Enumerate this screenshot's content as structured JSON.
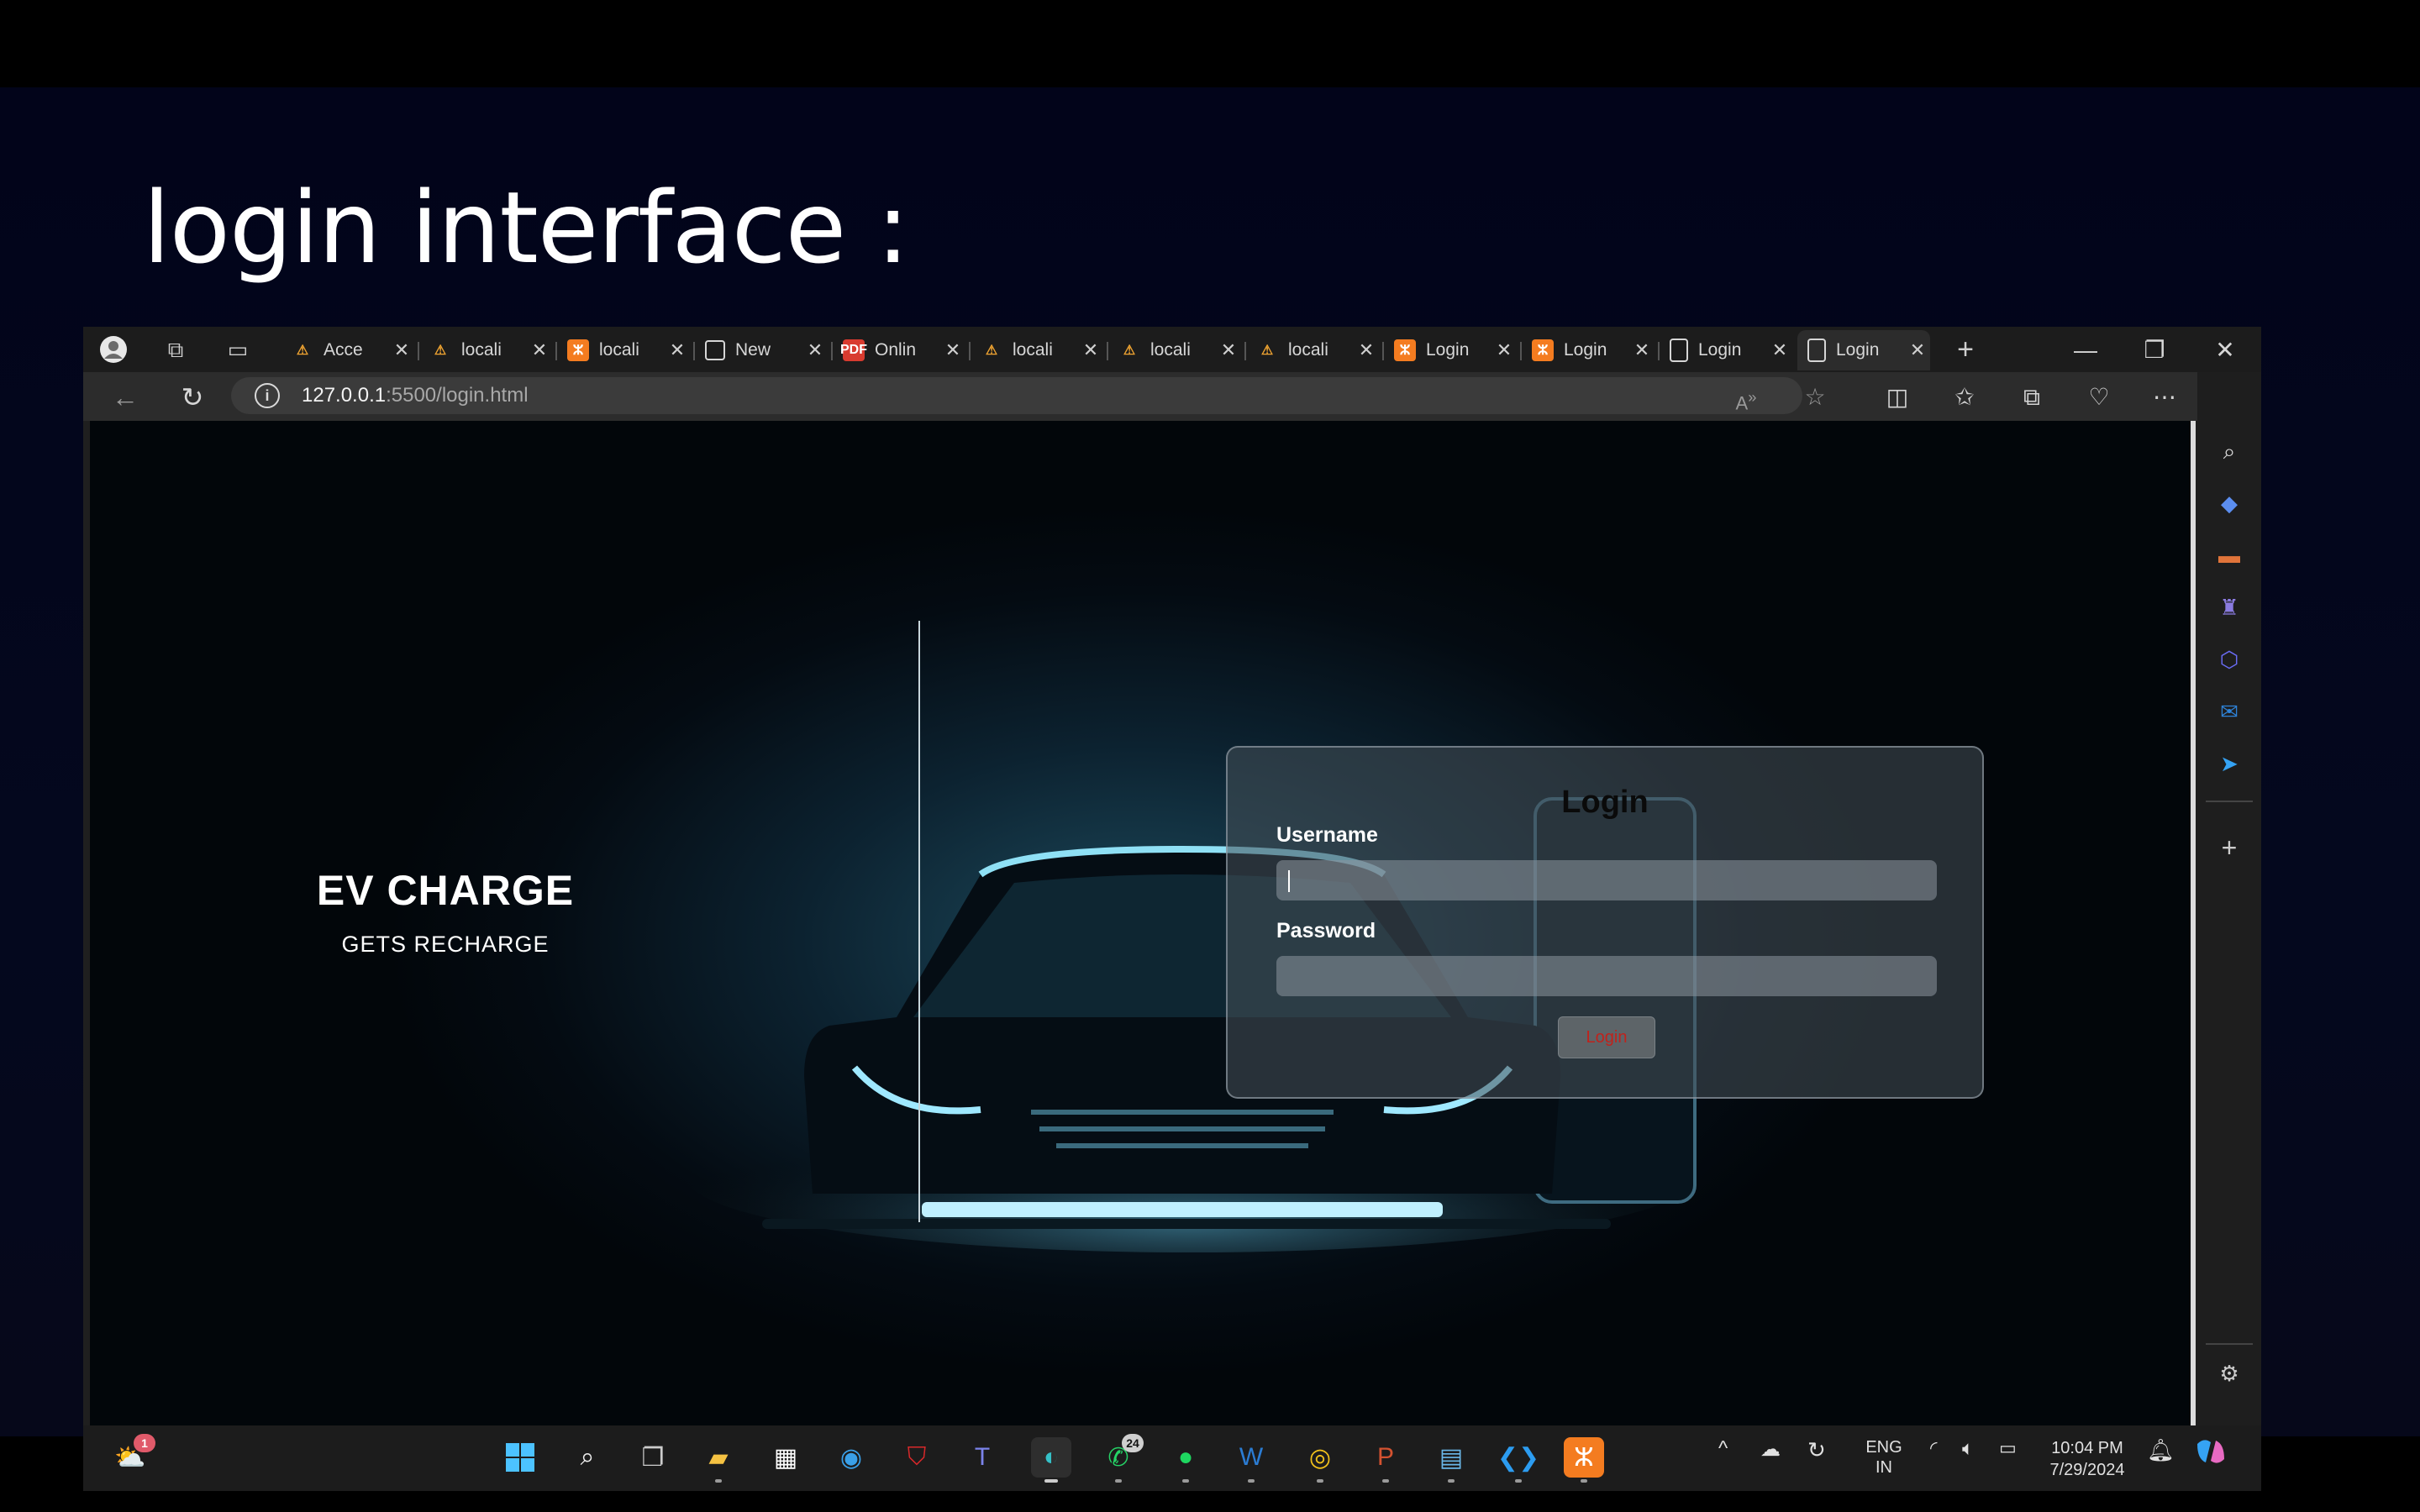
{
  "slide": {
    "title": "login interface :"
  },
  "browser": {
    "tabs": [
      {
        "label": "Acce",
        "icon": "warning-icon"
      },
      {
        "label": "locali",
        "icon": "warning-icon"
      },
      {
        "label": "locali",
        "icon": "xampp-icon"
      },
      {
        "label": "New",
        "icon": "calendar-icon"
      },
      {
        "label": "Onlin",
        "icon": "pdf-icon"
      },
      {
        "label": "locali",
        "icon": "warning-icon"
      },
      {
        "label": "locali",
        "icon": "warning-icon"
      },
      {
        "label": "locali",
        "icon": "warning-icon"
      },
      {
        "label": "Login",
        "icon": "xampp-icon"
      },
      {
        "label": "Login",
        "icon": "xampp-icon"
      },
      {
        "label": "Login",
        "icon": "document-icon"
      },
      {
        "label": "Login",
        "icon": "document-icon"
      }
    ],
    "url_host": "127.0.0.1",
    "url_path": ":5500/login.html"
  },
  "page": {
    "brand_title": "EV CHARGE",
    "brand_subtitle": "GETS RECHARGE",
    "login": {
      "title": "Login",
      "username_label": "Username",
      "password_label": "Password",
      "button_label": "Login"
    }
  },
  "taskbar": {
    "weather_badge": "1",
    "whatsapp_badge": "24",
    "lang_line1": "ENG",
    "lang_line2": "IN",
    "time": "10:04 PM",
    "date": "7/29/2024"
  }
}
